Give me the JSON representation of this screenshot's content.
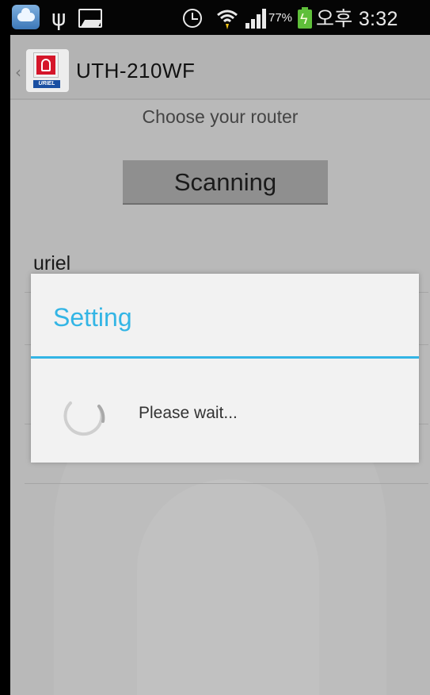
{
  "status_bar": {
    "battery_percent": "77%",
    "clock": "오후 3:32",
    "icons": [
      "cloud-icon",
      "usb-icon",
      "gallery-icon",
      "alarm-icon",
      "wifi-icon",
      "signal-icon",
      "battery-charging-icon"
    ]
  },
  "action_bar": {
    "title": "UTH-210WF",
    "app_icon_text": "URIEL"
  },
  "main": {
    "choose_label": "Choose your router",
    "scan_button_label": "Scanning",
    "routers": [
      "uriel"
    ]
  },
  "dialog": {
    "title": "Setting",
    "message": "Please wait..."
  },
  "colors": {
    "accent": "#33b5e5",
    "status_bar_bg": "#050505",
    "dimmed_background": "#b9b9b9",
    "battery": "#5fbf3a"
  }
}
